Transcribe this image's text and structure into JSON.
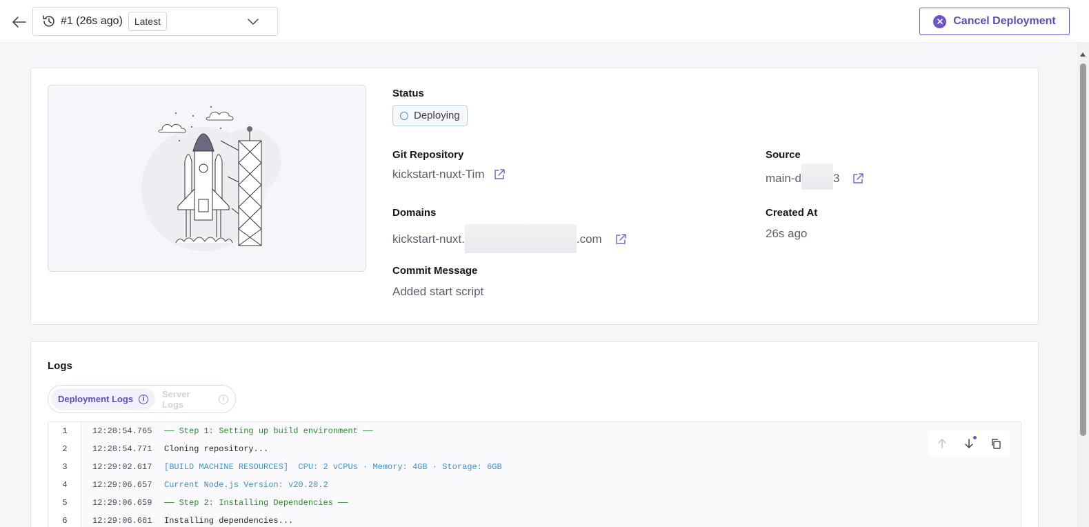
{
  "header": {
    "deployment_selector": "#1 (26s ago)",
    "latest_badge": "Latest",
    "cancel_label": "Cancel Deployment"
  },
  "details": {
    "status_label": "Status",
    "status_value": "Deploying",
    "git_label": "Git Repository",
    "git_value": "kickstart-nuxt-Tim",
    "source_label": "Source",
    "source_prefix": "main-d",
    "source_suffix": "3",
    "domains_label": "Domains",
    "domain_prefix": "kickstart-nuxt.",
    "domain_suffix": ".com",
    "created_label": "Created At",
    "created_value": "26s ago",
    "commit_label": "Commit Message",
    "commit_value": "Added start script"
  },
  "logs": {
    "title": "Logs",
    "tabs": [
      {
        "label": "Deployment Logs",
        "active": true
      },
      {
        "label": "Server Logs",
        "active": false
      }
    ],
    "lines": [
      {
        "n": "1",
        "time": "12:28:54.765",
        "text": "── Step 1: Setting up build environment ──",
        "tone": "green"
      },
      {
        "n": "2",
        "time": "12:28:54.771",
        "text": "Cloning repository...",
        "tone": "default"
      },
      {
        "n": "3",
        "time": "12:29:02.617",
        "text": "[BUILD MACHINE RESOURCES]  CPU: 2 vCPUs · Memory: 4GB · Storage: 6GB",
        "tone": "blue"
      },
      {
        "n": "4",
        "time": "12:29:06.657",
        "text": "Current Node.js Version: v20.20.2",
        "tone": "blue"
      },
      {
        "n": "5",
        "time": "12:29:06.659",
        "text": "── Step 2: Installing Dependencies ──",
        "tone": "green"
      },
      {
        "n": "6",
        "time": "12:29:06.661",
        "text": "Installing dependencies...",
        "tone": "default"
      }
    ]
  },
  "colors": {
    "accent": "#6b54c7",
    "status_ring": "#4a8fc9",
    "log_green": "#2f8a2f",
    "log_blue": "#3b8fd6"
  },
  "icons": [
    "back-arrow-icon",
    "history-icon",
    "chevron-down-icon",
    "x-circle-icon",
    "external-link-icon",
    "info-icon",
    "arrow-up-icon",
    "arrow-down-icon",
    "copy-icon"
  ]
}
